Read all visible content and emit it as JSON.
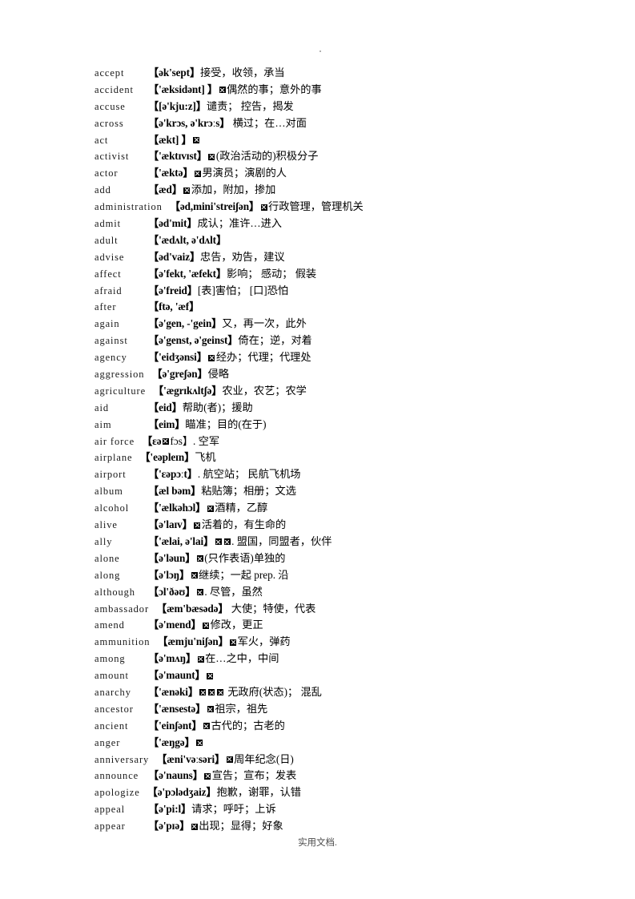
{
  "document": {
    "footer_text": "实用文档.",
    "top_mark": "."
  },
  "entries": [
    {
      "word": "accept",
      "phonetic": "【ək'sept】",
      "boxes": 0,
      "gloss": "接受，收领，承当",
      "wide": false
    },
    {
      "word": "accident",
      "phonetic": "【'æksidənt] 】",
      "boxes": 1,
      "gloss": "偶然的事；意外的事",
      "wide": false
    },
    {
      "word": "accuse",
      "phonetic": "【[ə'kju:z]】",
      "boxes": 0,
      "gloss": "谴责；  控告，揭发",
      "wide": false
    },
    {
      "word": "across",
      "phonetic": "【ə'krɔs, ə'krɔːs】",
      "boxes": 0,
      "gloss": " 横过；在…对面",
      "wide": false
    },
    {
      "word": "act",
      "phonetic": "【ækt] 】",
      "boxes": 1,
      "gloss": "",
      "wide": false
    },
    {
      "word": "activist",
      "phonetic": "【'æktɪvɪst】",
      "boxes": 1,
      "gloss": "(政治活动的)积极分子",
      "wide": false
    },
    {
      "word": "actor",
      "phonetic": "【'æktə】",
      "boxes": 1,
      "gloss": "男演员；演剧的人",
      "wide": false
    },
    {
      "word": "add",
      "phonetic": "【æd】",
      "boxes": 1,
      "gloss": "添加，附加，掺加",
      "wide": false
    },
    {
      "word": "administration",
      "phonetic": "【əd,mini'streiʃən】",
      "boxes": 1,
      "gloss": "行政管理，管理机关",
      "wide": true
    },
    {
      "word": "admit",
      "phonetic": "【əd'mit】",
      "boxes": 0,
      "gloss": "成认；准许…进入",
      "wide": false
    },
    {
      "word": "adult",
      "phonetic": "【'ædʌlt, ə'dʌlt】",
      "boxes": 0,
      "gloss": "",
      "wide": false
    },
    {
      "word": "advise",
      "phonetic": "【əd'vaiz】",
      "boxes": 0,
      "gloss": "忠告，劝告，建议",
      "wide": false
    },
    {
      "word": "affect",
      "phonetic": "【ə'fekt, 'æfekt】",
      "boxes": 0,
      "gloss": "影响；  感动；  假装",
      "wide": false
    },
    {
      "word": "afraid",
      "phonetic": "【ə'freid】",
      "boxes": 0,
      "gloss": "[表]害怕；  [口]恐怕",
      "wide": false
    },
    {
      "word": "after",
      "phonetic": "【ftə, 'æf】",
      "boxes": 0,
      "gloss": "",
      "wide": false
    },
    {
      "word": "again",
      "phonetic": "【ə'gen, -'gein】",
      "boxes": 0,
      "gloss": "又，再一次，此外",
      "wide": false
    },
    {
      "word": "against",
      "phonetic": "【ə'genst, ə'geinst】",
      "boxes": 0,
      "gloss": "倚在；逆，对着",
      "wide": false
    },
    {
      "word": "agency",
      "phonetic": "【'eidʒənsi】",
      "boxes": 1,
      "gloss": "经办；代理；代理处",
      "wide": false
    },
    {
      "word": "aggression",
      "phonetic": "【ə'greʃən】",
      "boxes": 0,
      "gloss": "侵略",
      "wide": true
    },
    {
      "word": "agriculture",
      "phonetic": "【'ægrɪkʌltʃə】",
      "boxes": 0,
      "gloss": "农业，农艺；农学",
      "wide": true
    },
    {
      "word": "aid",
      "phonetic": "【eid】",
      "boxes": 0,
      "gloss": "帮助(者)；援助",
      "wide": false
    },
    {
      "word": "aim",
      "phonetic": "【eim】",
      "boxes": 0,
      "gloss": "瞄准；目的(在于)",
      "wide": false
    },
    {
      "word": "air force",
      "phonetic": "【ɛə",
      "boxes": 1,
      "gloss": "fɔs】. 空军",
      "wide": true
    },
    {
      "word": "airplane",
      "phonetic": "【'eəpleɪn】",
      "boxes": 0,
      "gloss": "飞机",
      "wide": true
    },
    {
      "word": "airport",
      "phonetic": "【'ɛəpɔːt】",
      "boxes": 0,
      "gloss": ". 航空站；  民航飞机场",
      "wide": false
    },
    {
      "word": "album",
      "phonetic": "【æl bəm】",
      "boxes": 0,
      "gloss": "粘贴簿；相册；文选",
      "wide": false
    },
    {
      "word": "alcohol",
      "phonetic": "【'ælkəhɔl】",
      "boxes": 1,
      "gloss": "酒精，乙醇",
      "wide": false
    },
    {
      "word": "alive",
      "phonetic": "【ə'laɪv】",
      "boxes": 1,
      "gloss": "活着的，有生命的",
      "wide": false
    },
    {
      "word": "ally",
      "phonetic": "【'ælai, ə'lai】",
      "boxes": 2,
      "gloss": ". 盟国，同盟者，伙伴",
      "wide": false
    },
    {
      "word": "alone",
      "phonetic": "【ə'ləun】",
      "boxes": 1,
      "gloss": "(只作表语)单独的",
      "wide": false
    },
    {
      "word": "along",
      "phonetic": "【ə'lɔŋ】",
      "boxes": 1,
      "gloss": "继续；一起 prep. 沿",
      "wide": false
    },
    {
      "word": "although",
      "phonetic": "【ɔl'ðəʊ】",
      "boxes": 1,
      "gloss": ". 尽管，虽然",
      "wide": false
    },
    {
      "word": "ambassador",
      "phonetic": "【æm'bæsədə】",
      "boxes": 0,
      "gloss": " 大使；特使，代表",
      "wide": true
    },
    {
      "word": "amend",
      "phonetic": "【ə'mend】",
      "boxes": 1,
      "gloss": "修改，更正",
      "wide": false
    },
    {
      "word": "ammunition",
      "phonetic": "【æmju'niʃən】",
      "boxes": 1,
      "gloss": "军火，弹药",
      "wide": true
    },
    {
      "word": "among",
      "phonetic": "【ə'mʌŋ】",
      "boxes": 1,
      "gloss": "在…之中，中间",
      "wide": false
    },
    {
      "word": "amount",
      "phonetic": "【ə'maunt】",
      "boxes": 1,
      "gloss": "",
      "wide": false
    },
    {
      "word": "anarchy",
      "phonetic": "【'ænəki】",
      "boxes": 3,
      "gloss": " 无政府(状态)；  混乱",
      "wide": false
    },
    {
      "word": "ancestor",
      "phonetic": "【'ænsestə】",
      "boxes": 1,
      "gloss": "祖宗，祖先",
      "wide": false
    },
    {
      "word": "ancient",
      "phonetic": "【'einʃənt】",
      "boxes": 1,
      "gloss": "古代的；古老的",
      "wide": false
    },
    {
      "word": "anger",
      "phonetic": "【'æŋgə】",
      "boxes": 1,
      "gloss": "",
      "wide": false
    },
    {
      "word": "anniversary",
      "phonetic": "【æni'vəːsəri】",
      "boxes": 1,
      "gloss": "周年纪念(日)",
      "wide": true
    },
    {
      "word": "announce",
      "phonetic": "【ə'nauns】",
      "boxes": 1,
      "gloss": "宣告；宣布；发表",
      "wide": false
    },
    {
      "word": "apologize",
      "phonetic": "【ə'pɔlədʒaiz】",
      "boxes": 0,
      "gloss": "抱歉，谢罪，认错",
      "wide": true
    },
    {
      "word": "appeal",
      "phonetic": "【ə'pi:l】",
      "boxes": 0,
      "gloss": "请求；呼吁；上诉",
      "wide": false
    },
    {
      "word": "appear",
      "phonetic": "【ə'pɪə】",
      "boxes": 1,
      "gloss": "出现；显得；好象",
      "wide": false
    }
  ]
}
